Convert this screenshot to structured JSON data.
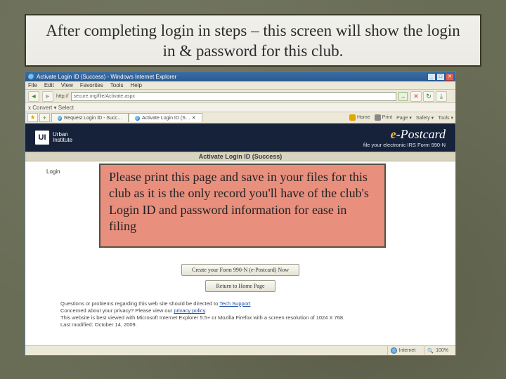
{
  "title": "After completing login in steps – this screen will show the login in & password for this club.",
  "browser": {
    "window_title": "Activate Login ID (Success) - Windows Internet Explorer",
    "menus": [
      "File",
      "Edit",
      "View",
      "Favorites",
      "Tools",
      "Help"
    ],
    "back": "◄",
    "fwd": "►",
    "addr_label": "http://",
    "address": "secure.org/file/Activate.aspx",
    "go": "→",
    "toolbelt": "x  Convert  ▾  Select",
    "tabs": {
      "star": "★",
      "add": "+",
      "t1": "Request Login ID - Succ…",
      "t2": "Activate Login ID (S… ✕"
    },
    "right_tools": {
      "home": "Home",
      "print": "Print",
      "page": "Page ▾",
      "safety": "Safety ▾",
      "tools": "Tools ▾"
    }
  },
  "header": {
    "urban_mark": "UI",
    "urban_line1": "Urban",
    "urban_line2": "Institute",
    "ep_e": "e",
    "ep_rest": "-Postcard",
    "ep_sub": "file your electronic IRS Form 990-N"
  },
  "success_bar": "Activate Login ID (Success)",
  "body": {
    "label_login": "Login",
    "label_pass": " ",
    "label_note": " "
  },
  "overlay_note": "Please print this page and save in your files for this club as it is the only record you'll have of the club's Login ID and password information for ease in filing",
  "btn_create": "Create your Form 990-N (e-Postcard) Now",
  "btn_return": "Return to Home Page",
  "footer": {
    "l1a": "Questions or problems regarding this web site should be directed to ",
    "l1b": "Tech Support",
    "l2a": "Concerned about your privacy? Please view our ",
    "l2b": "privacy policy",
    "l2c": ".",
    "l3": "This website is best viewed with Microsoft Internet Explorer 5.5+ or Mozilla Firefox with a screen resolution of 1024 X 768.",
    "l4": "Last modified: October 14, 2009."
  },
  "status": {
    "zone": "Internet",
    "zoom": "100%"
  }
}
